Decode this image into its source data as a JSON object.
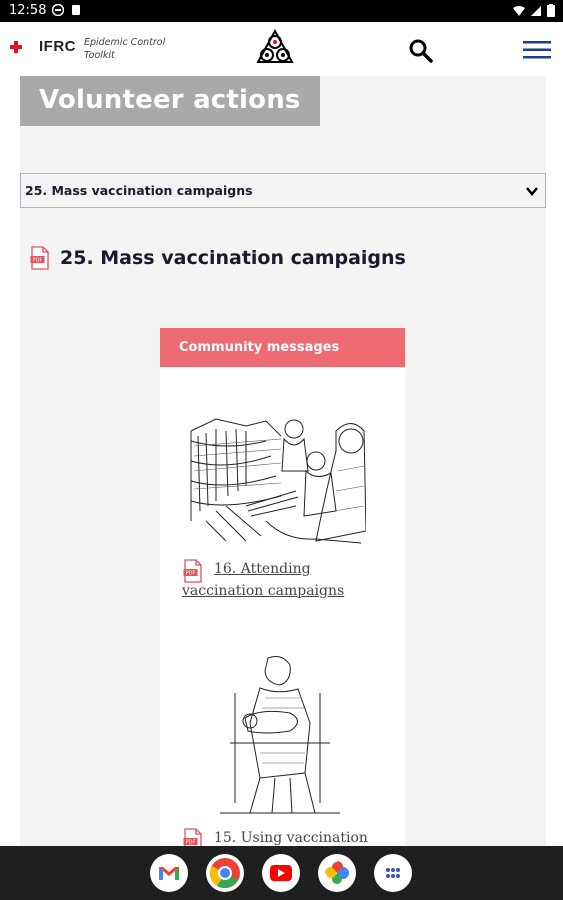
{
  "status_bar": {
    "time": "12:58"
  },
  "app_bar": {
    "logo_text": "IFRC",
    "toolkit_name": "Epidemic Control Toolkit"
  },
  "page": {
    "title": "Volunteer actions",
    "select_value": "25. Mass vaccination campaigns",
    "section_heading": "25. Mass vaccination campaigns"
  },
  "card": {
    "header": "Community messages",
    "items": [
      {
        "label": "16. Attending vaccination campaigns"
      },
      {
        "label": "15. Using vaccination"
      }
    ]
  },
  "nav_apps": [
    "gmail-icon",
    "chrome-icon",
    "youtube-icon",
    "photos-icon",
    "apps-icon"
  ],
  "colors": {
    "card_header": "#ee6b73",
    "title_box": "#a9a9a9",
    "menu_icon": "#1c3f94",
    "brand_red": "#e1131f"
  }
}
